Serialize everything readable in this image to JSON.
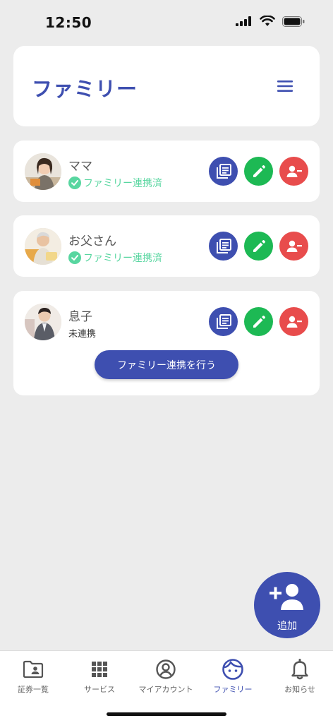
{
  "status_bar": {
    "time": "12:50"
  },
  "header": {
    "title": "ファミリー"
  },
  "members": [
    {
      "name": "ママ",
      "status": "ファミリー連携済",
      "linked": true
    },
    {
      "name": "お父さん",
      "status": "ファミリー連携済",
      "linked": true
    },
    {
      "name": "息子",
      "status": "未連携",
      "linked": false,
      "link_button": "ファミリー連携を行う"
    }
  ],
  "fab": {
    "label": "追加"
  },
  "nav": {
    "items": [
      {
        "label": "証券一覧",
        "icon": "folder-person-icon"
      },
      {
        "label": "サービス",
        "icon": "grid-icon"
      },
      {
        "label": "マイアカウント",
        "icon": "account-circle-icon"
      },
      {
        "label": "ファミリー",
        "icon": "face-icon",
        "active": true
      },
      {
        "label": "お知らせ",
        "icon": "bell-icon"
      }
    ]
  },
  "colors": {
    "primary": "#3e4fb0",
    "edit": "#1db954",
    "remove": "#e84c4c",
    "linked": "#58d6a0",
    "background": "#ececec"
  }
}
